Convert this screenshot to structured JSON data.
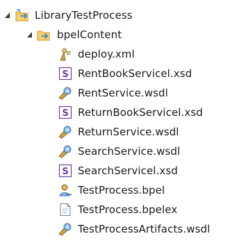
{
  "tree": {
    "project": {
      "label": "LibraryTestProcess",
      "icon": "project-folder-icon",
      "expanded": true
    },
    "folder": {
      "label": "bpelContent",
      "icon": "folder-icon",
      "expanded": true
    },
    "files": [
      {
        "label": "deploy.xml",
        "icon": "deploy-xml-icon"
      },
      {
        "label": "RentBookServicel.xsd",
        "icon": "xsd-schema-icon"
      },
      {
        "label": "RentService.wsdl",
        "icon": "wsdl-icon"
      },
      {
        "label": "ReturnBookServicel.xsd",
        "icon": "xsd-schema-icon"
      },
      {
        "label": "ReturnService.wsdl",
        "icon": "wsdl-icon"
      },
      {
        "label": "SearchService.wsdl",
        "icon": "wsdl-icon"
      },
      {
        "label": "SearchServicel.xsd",
        "icon": "xsd-schema-icon"
      },
      {
        "label": "TestProcess.bpel",
        "icon": "bpel-process-icon"
      },
      {
        "label": "TestProcess.bpelex",
        "icon": "document-icon"
      },
      {
        "label": "TestProcessArtifacts.wsdl",
        "icon": "wsdl-icon"
      }
    ]
  },
  "colors": {
    "folder_fill": "#f6cf6a",
    "folder_edge": "#c99a2e",
    "arrow_blue": "#2e7bd6",
    "schema_purple": "#6b3f9c",
    "twisty": "#3a3a3a"
  }
}
